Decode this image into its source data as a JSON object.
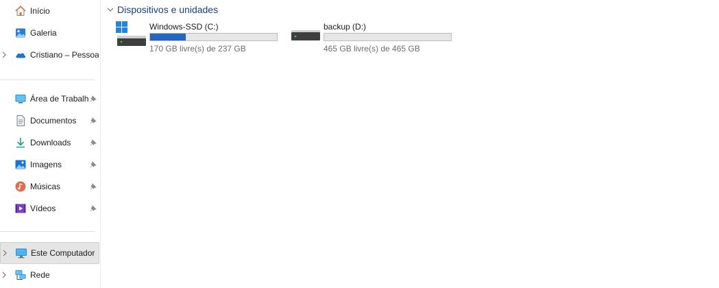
{
  "sidebar": {
    "items": [
      {
        "label": "Início",
        "icon": "home-icon",
        "pinned": false,
        "expandable": false
      },
      {
        "label": "Galeria",
        "icon": "gallery-icon",
        "pinned": false,
        "expandable": false
      },
      {
        "label": "Cristiano – Pessoal",
        "icon": "onedrive-cloud-icon",
        "pinned": false,
        "expandable": true
      },
      {
        "label": "Área de Trabalho",
        "icon": "desktop-icon",
        "pinned": true,
        "expandable": false
      },
      {
        "label": "Documentos",
        "icon": "documents-icon",
        "pinned": true,
        "expandable": false
      },
      {
        "label": "Downloads",
        "icon": "downloads-icon",
        "pinned": true,
        "expandable": false
      },
      {
        "label": "Imagens",
        "icon": "pictures-icon",
        "pinned": true,
        "expandable": false
      },
      {
        "label": "Músicas",
        "icon": "music-icon",
        "pinned": true,
        "expandable": false
      },
      {
        "label": "Vídeos",
        "icon": "videos-icon",
        "pinned": true,
        "expandable": false
      },
      {
        "label": "Este Computador",
        "icon": "this-pc-icon",
        "pinned": false,
        "expandable": true,
        "selected": true
      },
      {
        "label": "Rede",
        "icon": "network-icon",
        "pinned": false,
        "expandable": true
      }
    ]
  },
  "main": {
    "group_title": "Dispositivos e unidades",
    "drives": [
      {
        "name": "Windows-SSD (C:)",
        "free_text": "170 GB livre(s) de 237 GB",
        "used_fraction": 0.283,
        "icon": "windows-drive-icon"
      },
      {
        "name": "backup (D:)",
        "free_text": "465 GB livre(s) de 465 GB",
        "used_fraction": 0.0,
        "icon": "hard-drive-icon"
      }
    ]
  },
  "colors": {
    "accent": "#2266c2",
    "group_title": "#1e3c78",
    "selected_bg": "#e5e5e5"
  }
}
